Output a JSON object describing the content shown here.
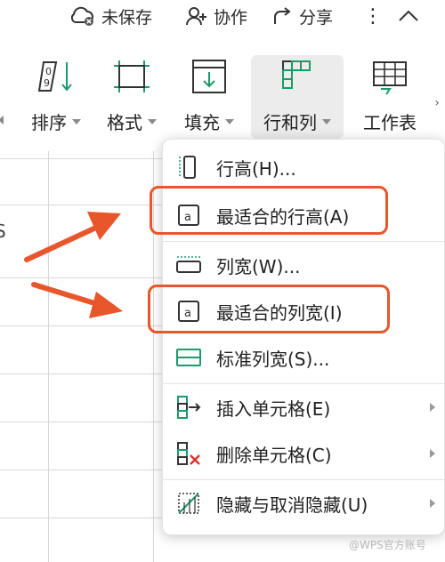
{
  "topbar": {
    "unsaved_label": "未保存",
    "collab_label": "协作",
    "share_label": "分享",
    "more_glyph": "⋮"
  },
  "ribbon": {
    "items": [
      {
        "label": "排序",
        "icon": "sort-icon"
      },
      {
        "label": "格式",
        "icon": "format-icon"
      },
      {
        "label": "填充",
        "icon": "fill-icon"
      },
      {
        "label": "行和列",
        "icon": "row-col-icon",
        "active": true
      },
      {
        "label": "工作表",
        "icon": "worksheet-icon"
      }
    ]
  },
  "sheet": {
    "column_letter": "S"
  },
  "menu": {
    "items": [
      {
        "label": "行高(H)...",
        "icon": "row-height-icon",
        "submenu": false
      },
      {
        "label": "最适合的行高(A)",
        "icon": "autofit-row-icon",
        "submenu": false,
        "highlighted": true
      },
      {
        "label": "列宽(W)...",
        "icon": "column-width-icon",
        "submenu": false
      },
      {
        "label": "最适合的列宽(I)",
        "icon": "autofit-column-icon",
        "submenu": false,
        "highlighted": true
      },
      {
        "label": "标准列宽(S)...",
        "icon": "standard-width-icon",
        "submenu": false
      },
      {
        "label": "插入单元格(E)",
        "icon": "insert-cells-icon",
        "submenu": true
      },
      {
        "label": "删除单元格(C)",
        "icon": "delete-cells-icon",
        "submenu": true
      },
      {
        "label": "隐藏与取消隐藏(U)",
        "icon": "hide-unhide-icon",
        "submenu": true
      }
    ]
  },
  "colors": {
    "highlight": "#e8562b",
    "arrow": "#e8562b",
    "active_tab_bg": "#ececec"
  },
  "watermark": "@WPS官方账号"
}
